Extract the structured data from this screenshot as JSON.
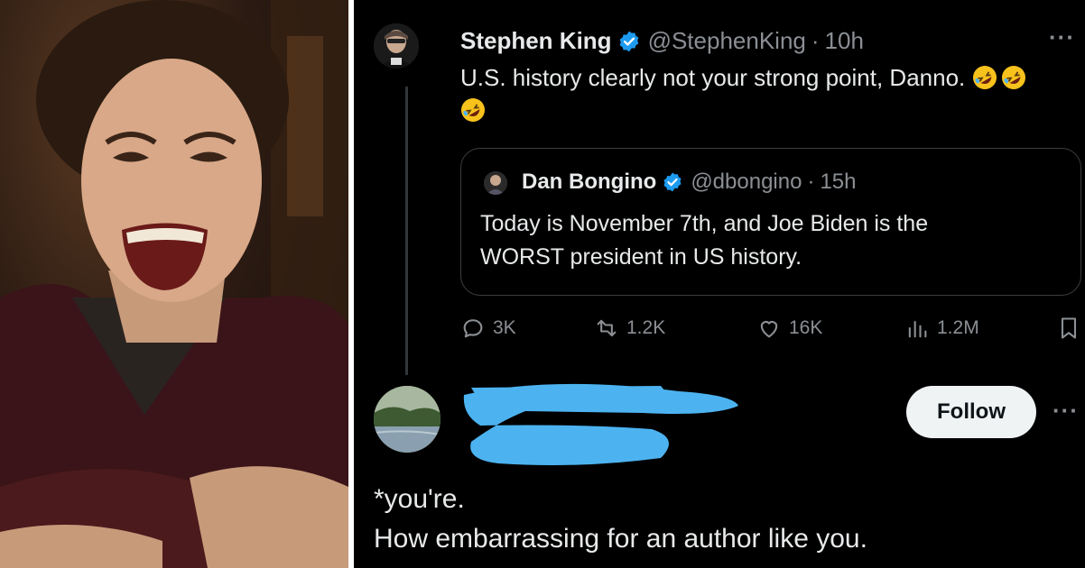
{
  "photo": {
    "icon": "smiling-man-photo"
  },
  "tweet": {
    "author_name": "Stephen King",
    "author_handle": "@StephenKing",
    "separator": "·",
    "time": "10h",
    "more": "···",
    "text": "U.S. history clearly not your strong point, Danno.",
    "emoji": "rolling-on-floor-laughing-icon"
  },
  "quote": {
    "author_name": "Dan Bongino",
    "author_handle": "@dbongino",
    "separator": "·",
    "time": "15h",
    "text_line1": "Today is November 7th, and Joe Biden is the",
    "text_line2": "WORST president in US history."
  },
  "actions": {
    "replies": "3K",
    "reposts": "1.2K",
    "likes": "16K",
    "views": "1.2M"
  },
  "reply": {
    "follow_label": "Follow",
    "more": "···",
    "line1": "*you're.",
    "line2": "How embarrassing for an author like you."
  },
  "colors": {
    "background": "#000000",
    "text": "#e7e9ea",
    "muted": "#8b8f94",
    "verified": "#1d9bf0",
    "redaction": "#4cb3f0"
  }
}
